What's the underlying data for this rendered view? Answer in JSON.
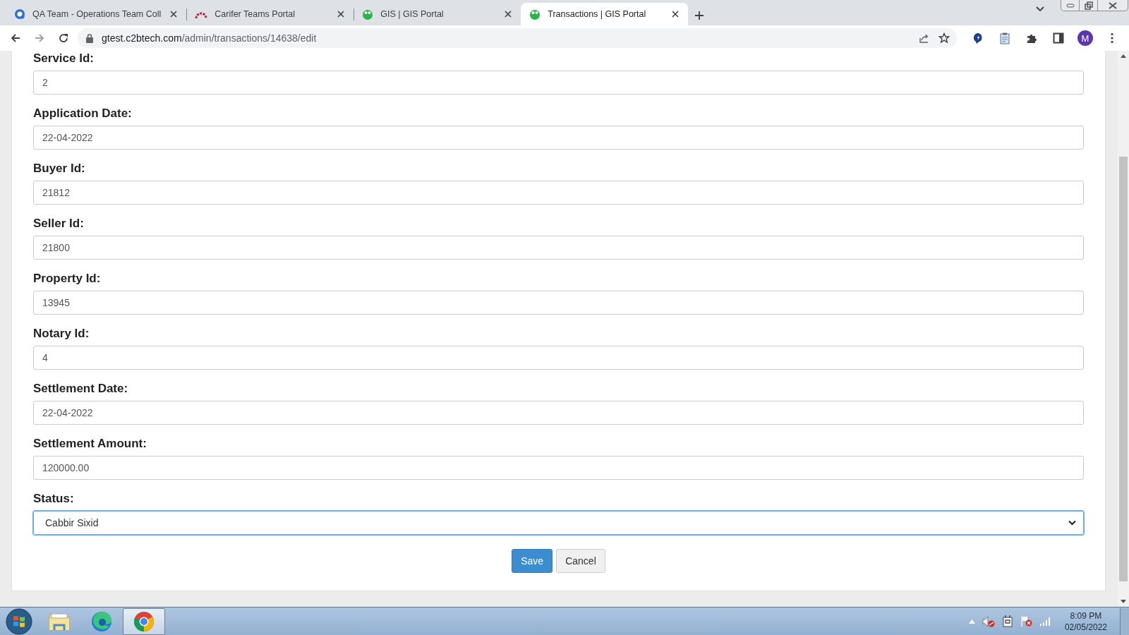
{
  "browser": {
    "tabs": [
      {
        "title": "QA Team - Operations Team Coll",
        "selected": false
      },
      {
        "title": "Carifer Teams Portal",
        "selected": false
      },
      {
        "title": "GIS | GIS Portal",
        "selected": false
      },
      {
        "title": "Transactions | GIS Portal",
        "selected": true
      }
    ],
    "url_host": "gtest.c2btech.com",
    "url_path": "/admin/transactions/14638/edit",
    "profile_initial": "M"
  },
  "form": {
    "fields": [
      {
        "label": "Service Id:",
        "kind": "text",
        "value": "2"
      },
      {
        "label": "Application Date:",
        "kind": "text",
        "value": "22-04-2022"
      },
      {
        "label": "Buyer Id:",
        "kind": "text",
        "value": "21812"
      },
      {
        "label": "Seller Id:",
        "kind": "text",
        "value": "21800"
      },
      {
        "label": "Property Id:",
        "kind": "text",
        "value": "13945"
      },
      {
        "label": "Notary Id:",
        "kind": "text",
        "value": "4"
      },
      {
        "label": "Settlement Date:",
        "kind": "text",
        "value": "22-04-2022"
      },
      {
        "label": "Settlement Amount:",
        "kind": "text",
        "value": "120000.00"
      },
      {
        "label": "Status:",
        "kind": "select",
        "value": "Cabbir Sixid",
        "focused": true
      }
    ],
    "buttons": [
      {
        "label": "Save",
        "kind": "primary"
      },
      {
        "label": "Cancel",
        "kind": "secondary"
      }
    ]
  },
  "taskbar": {
    "apps": [
      {
        "active": false
      },
      {
        "active": false
      },
      {
        "active": true
      }
    ],
    "time": "8:09 PM",
    "date": "02/05/2022"
  }
}
